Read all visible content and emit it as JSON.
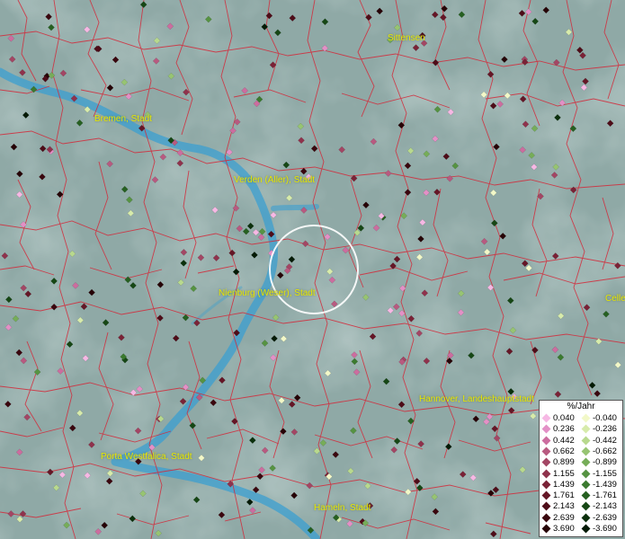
{
  "map": {
    "colors": {
      "background": "#8fa9a6",
      "river": "#3b9fd0",
      "boundaries": "#d32a3a",
      "label": "#e8e800"
    },
    "cities": [
      {
        "name": "Sittensen"
      },
      {
        "name": "Bremen, Stadt"
      },
      {
        "name": "Verden (Aller), Stadt"
      },
      {
        "name": "Nienburg (Weser), Stadt"
      },
      {
        "name": "Hannover, Landeshauptstadt"
      },
      {
        "name": "Porta Westfalica, Stadt"
      },
      {
        "name": "Hameln, Stadt"
      },
      {
        "name": "Celle"
      }
    ]
  },
  "legend": {
    "title": "%/Jahr",
    "positive": [
      {
        "label": "0.040",
        "color": "#f6b8e4"
      },
      {
        "label": "0.236",
        "color": "#e390c6"
      },
      {
        "label": "0.442",
        "color": "#cc6d9f"
      },
      {
        "label": "0.662",
        "color": "#b85a80"
      },
      {
        "label": "0.899",
        "color": "#a34664"
      },
      {
        "label": "1.155",
        "color": "#8f324c"
      },
      {
        "label": "1.439",
        "color": "#7a2236"
      },
      {
        "label": "1.761",
        "color": "#651626"
      },
      {
        "label": "2.143",
        "color": "#4e0c18"
      },
      {
        "label": "2.639",
        "color": "#3a060e"
      },
      {
        "label": "3.690",
        "color": "#260206"
      }
    ],
    "negative": [
      {
        "label": "-0.040",
        "color": "#f2f8c8"
      },
      {
        "label": "-0.236",
        "color": "#d7ebab"
      },
      {
        "label": "-0.442",
        "color": "#b8d98e"
      },
      {
        "label": "-0.662",
        "color": "#97c472"
      },
      {
        "label": "-0.899",
        "color": "#76ad58"
      },
      {
        "label": "-1.155",
        "color": "#569342"
      },
      {
        "label": "-1.439",
        "color": "#3b7a2f"
      },
      {
        "label": "-1.761",
        "color": "#266021"
      },
      {
        "label": "-2.143",
        "color": "#164715"
      },
      {
        "label": "-2.639",
        "color": "#0b300c"
      },
      {
        "label": "-3.690",
        "color": "#031a05"
      }
    ]
  }
}
